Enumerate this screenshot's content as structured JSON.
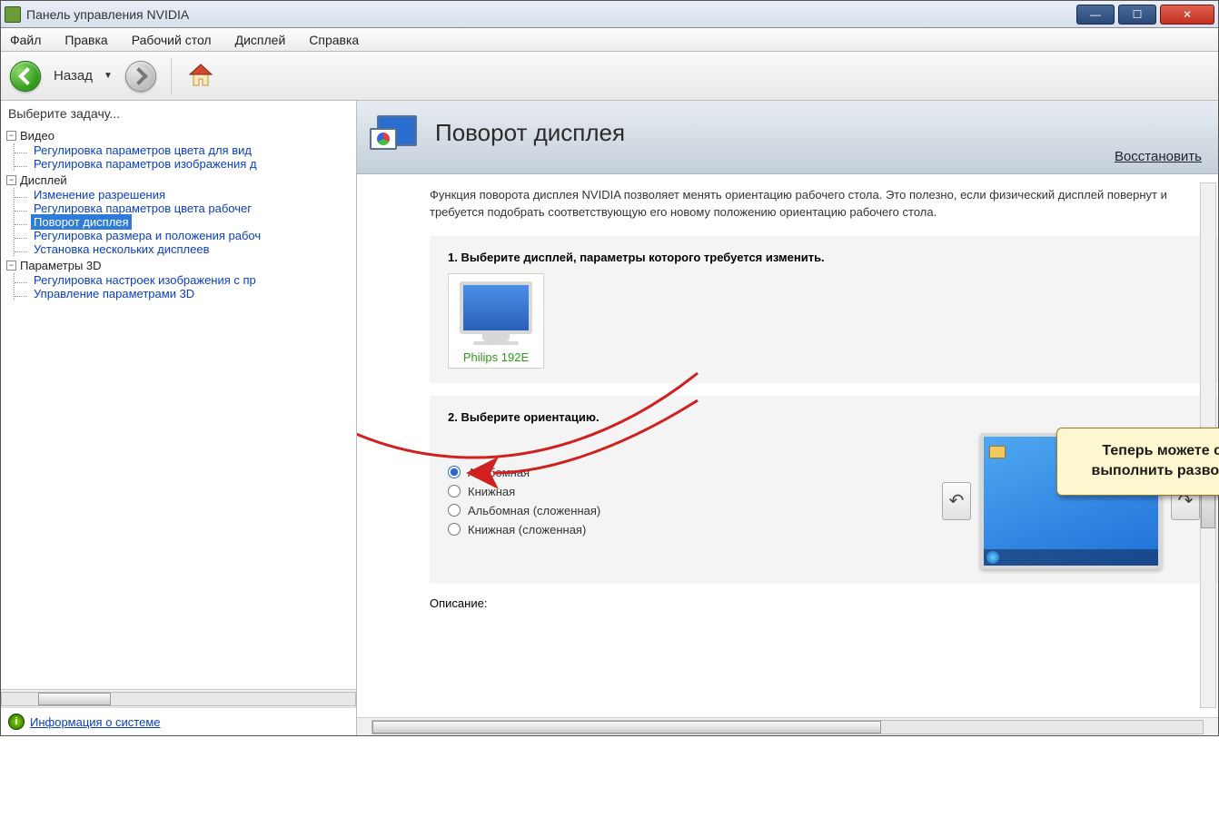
{
  "titlebar": {
    "title": "Панель управления NVIDIA"
  },
  "menu": {
    "file": "Файл",
    "edit": "Правка",
    "desktop": "Рабочий стол",
    "display": "Дисплей",
    "help": "Справка"
  },
  "toolbar": {
    "back_label": "Назад"
  },
  "sidebar": {
    "header": "Выберите задачу...",
    "groups": [
      {
        "label": "Видео",
        "items": [
          "Регулировка параметров цвета для вид",
          "Регулировка параметров изображения д"
        ]
      },
      {
        "label": "Дисплей",
        "items": [
          "Изменение разрешения",
          "Регулировка параметров цвета рабочег",
          "Поворот дисплея",
          "Регулировка размера и положения рабоч",
          "Установка нескольких дисплеев"
        ]
      },
      {
        "label": "Параметры 3D",
        "items": [
          "Регулировка настроек изображения с пр",
          "Управление параметрами 3D"
        ]
      }
    ],
    "selected": "Поворот дисплея",
    "sysinfo": "Информация о системе"
  },
  "page": {
    "title": "Поворот дисплея",
    "restore": "Восстановить",
    "description": "Функция поворота дисплея NVIDIA позволяет менять ориентацию рабочего стола. Это полезно, если физический дисплей повернут и требуется подобрать соответствующую его новому положению ориентацию рабочего стола.",
    "section1": {
      "title": "1. Выберите дисплей, параметры которого требуется изменить.",
      "display_name": "Philips 192E"
    },
    "section2": {
      "title": "2. Выберите ориентацию.",
      "options": [
        "Альбомная",
        "Книжная",
        "Альбомная (сложенная)",
        "Книжная (сложенная)"
      ],
      "selected": "Альбомная"
    },
    "desc_heading": "Описание:"
  },
  "callout": {
    "line1": "Теперь можете с легкостью",
    "line2": "выполнить разворот десплея!"
  }
}
